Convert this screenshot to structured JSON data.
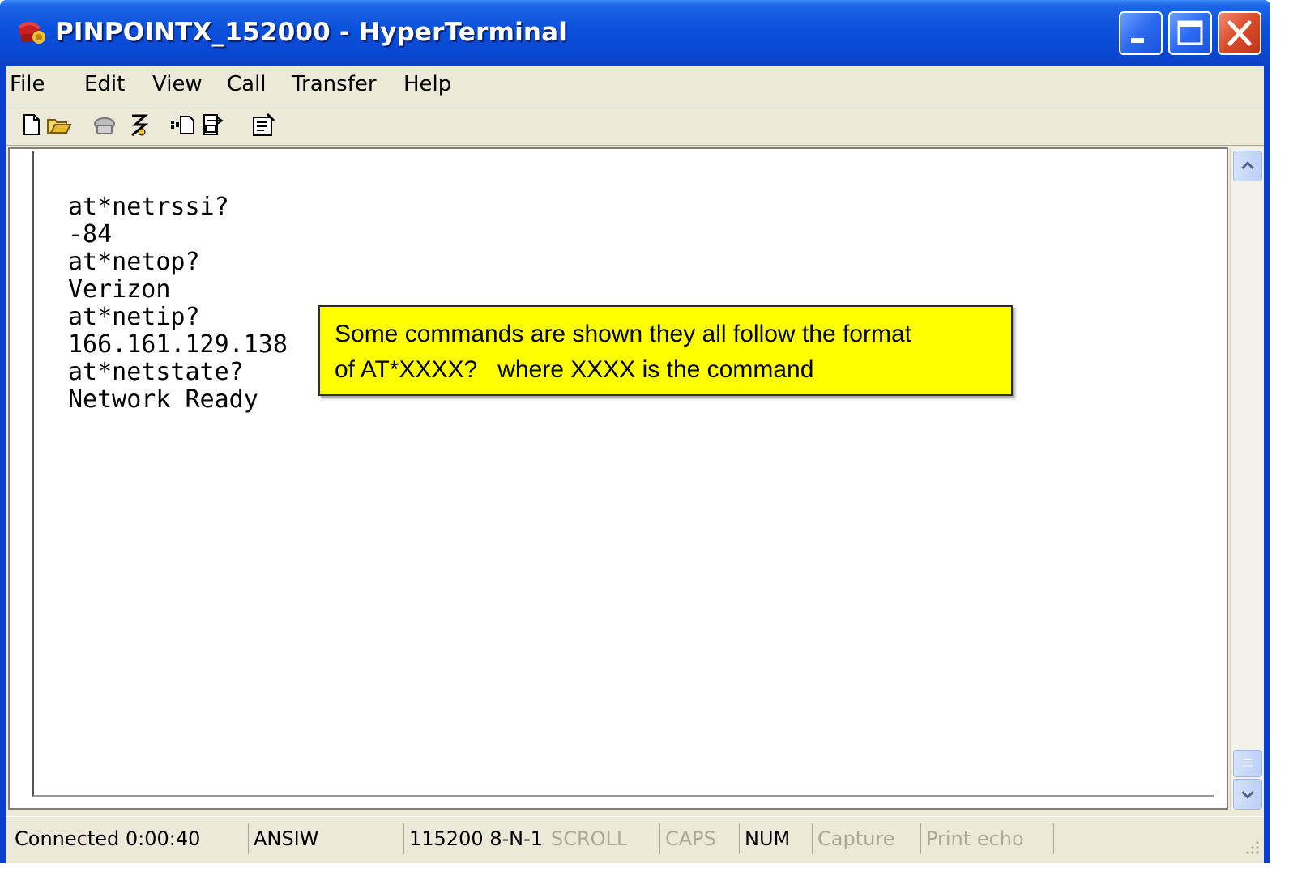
{
  "window": {
    "title": "PINPOINTX_152000 - HyperTerminal",
    "buttons": {
      "minimize": "minimize-icon",
      "maximize": "maximize-icon",
      "close": "close-icon"
    }
  },
  "menubar": {
    "items": [
      "File",
      "Edit",
      "View",
      "Call",
      "Transfer",
      "Help"
    ]
  },
  "toolbar": {
    "buttons": [
      {
        "name": "new-connection",
        "icon": "new-document-icon"
      },
      {
        "name": "open",
        "icon": "open-folder-icon"
      },
      {
        "name": "call",
        "icon": "phone-icon"
      },
      {
        "name": "disconnect",
        "icon": "hang-up-icon"
      },
      {
        "name": "send-file",
        "icon": "send-file-icon"
      },
      {
        "name": "receive-file",
        "icon": "receive-file-icon"
      },
      {
        "name": "properties",
        "icon": "properties-icon"
      }
    ]
  },
  "terminal": {
    "lines": [
      "at*netrssi?",
      "-84",
      "at*netop?",
      "Verizon",
      "at*netip?",
      "166.161.129.138",
      "at*netstate?",
      "Network Ready"
    ]
  },
  "callout": {
    "line1": "Some commands are shown they all follow the format",
    "line2": "of AT*XXXX?   where XXXX is the command",
    "background": "#ffff00"
  },
  "statusbar": {
    "connected": "Connected 0:00:40",
    "emulation": "ANSIW",
    "settings": "115200 8-N-1",
    "scroll": "SCROLL",
    "caps": "CAPS",
    "num": "NUM",
    "capture": "Capture",
    "print_echo": "Print echo"
  },
  "colors": {
    "titlebar": "#0a48d4",
    "chrome": "#ece9d8",
    "close_button": "#d94a2a"
  }
}
